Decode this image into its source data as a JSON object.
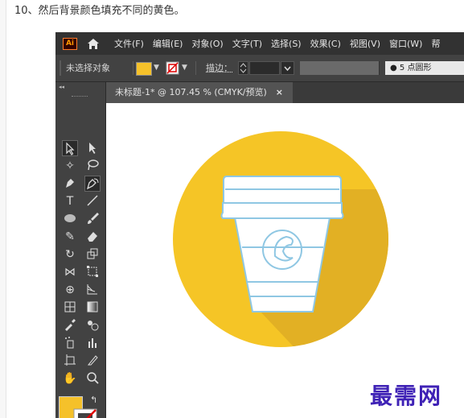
{
  "caption": "10、然后背景颜色填充不同的黄色。",
  "app": {
    "logo_text": "Ai"
  },
  "menu": [
    "文件(F)",
    "编辑(E)",
    "对象(O)",
    "文字(T)",
    "选择(S)",
    "效果(C)",
    "视图(V)",
    "窗口(W)",
    "帮"
  ],
  "control_bar": {
    "selection_status": "未选择对象",
    "stroke_label": "描边：",
    "brush_label": "5 点圆形"
  },
  "document_tab": {
    "title": "未标题-1* @ 107.45 % (CMYK/预览)",
    "close": "×"
  },
  "toolbar": {
    "collapse": "◂◂"
  },
  "watermark": "最需网",
  "colors": {
    "circle": "#f5c526",
    "shadow": "#e2b024",
    "cup_fill": "#ffffff",
    "cup_stroke": "#8fc7e3",
    "accent": "#f5c12a"
  }
}
